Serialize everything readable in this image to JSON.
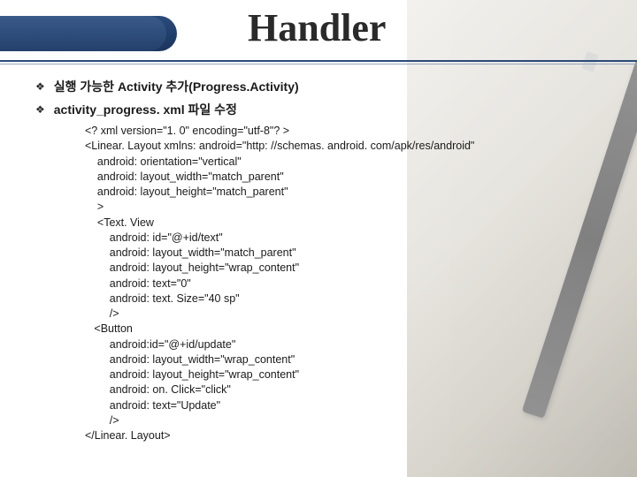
{
  "title": "Handler",
  "bullets": [
    {
      "label": "실행 가능한 Activity 추가(Progress.Activity)"
    },
    {
      "label": "activity_progress. xml 파일 수정"
    }
  ],
  "code": "<? xml version=\"1. 0\" encoding=\"utf-8\"? >\n<Linear. Layout xmlns: android=\"http: //schemas. android. com/apk/res/android\"\n    android: orientation=\"vertical\"\n    android: layout_width=\"match_parent\"\n    android: layout_height=\"match_parent\"\n    >\n    <Text. View\n        android: id=\"@+id/text\"\n        android: layout_width=\"match_parent\"\n        android: layout_height=\"wrap_content\"\n        android: text=\"0\"\n        android: text. Size=\"40 sp\"\n        />\n   <Button\n        android:id=\"@+id/update\"\n        android: layout_width=\"wrap_content\"\n        android: layout_height=\"wrap_content\"\n        android: on. Click=\"click\"\n        android: text=\"Update\"\n        />\n</Linear. Layout>"
}
